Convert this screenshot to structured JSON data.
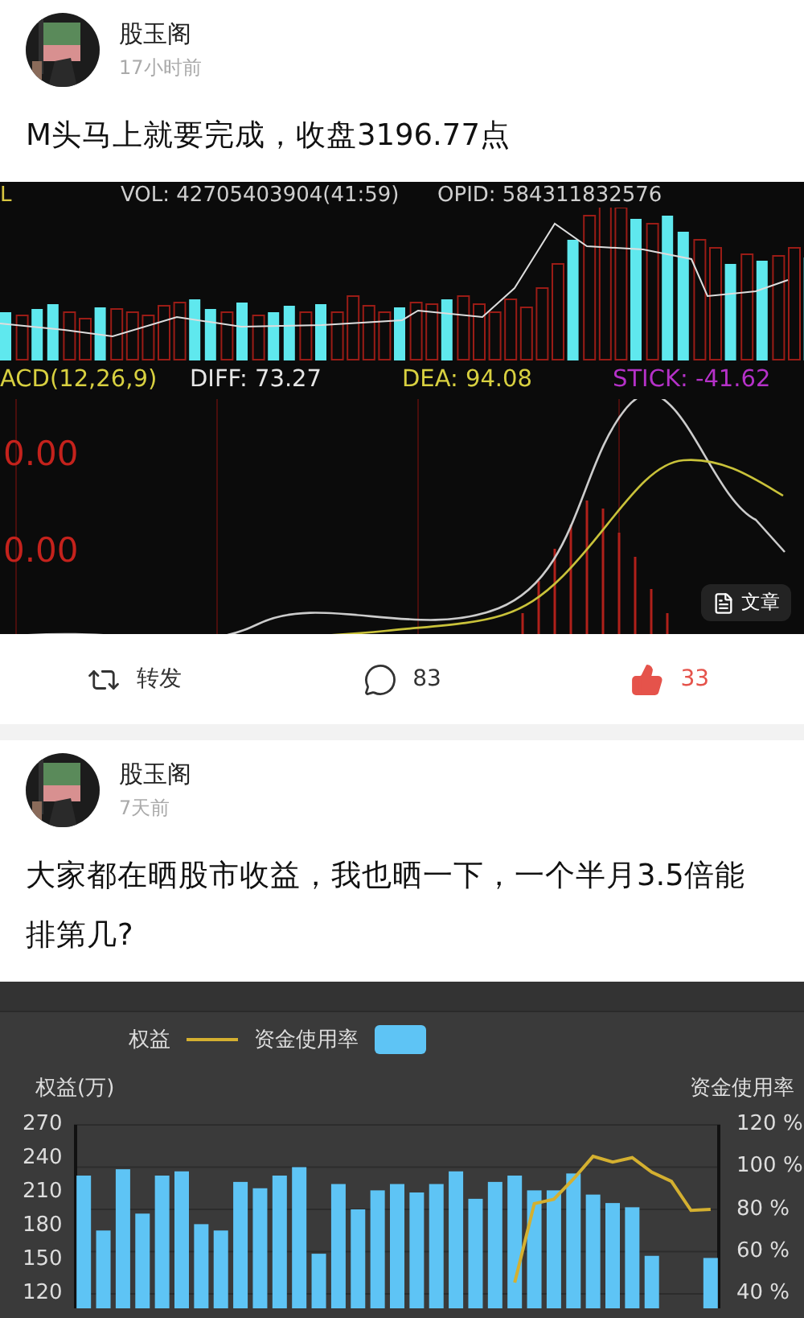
{
  "posts": [
    {
      "author": "股玉阁",
      "time": "17小时前",
      "text": "M头马上就要完成，收盘3196.77点",
      "avatar": {
        "kind": "picture"
      },
      "media": {
        "kind": "macd_screenshot",
        "top_labels": [
          {
            "text": "L",
            "color": "#d8c640"
          },
          {
            "text": "VOL: 42705403904(41:59)",
            "color": "#cfcfcf"
          },
          {
            "text": "OPID: 584311832576",
            "color": "#cfcfcf"
          }
        ],
        "macd_labels": [
          {
            "text": "ACD(12,26,9)",
            "color": "#d8d040"
          },
          {
            "text": "DIFF: 73.27",
            "color": "#e6e6e6"
          },
          {
            "text": "DEA: 94.08",
            "color": "#d8d040"
          },
          {
            "text": "STICK: -41.62",
            "color": "#b531c8"
          }
        ],
        "axis_labels": [
          "0.00",
          "0.00"
        ],
        "badge": "文章"
      },
      "actions": [
        {
          "kind": "share",
          "text": "转发"
        },
        {
          "kind": "comment",
          "text": "83"
        },
        {
          "kind": "like",
          "text": "33",
          "liked": true
        }
      ]
    },
    {
      "author": "股玉阁",
      "time": "7天前",
      "text": "大家都在晒股市收益，我也晒一下，一个半月3.5倍能排第几?",
      "avatar": {
        "kind": "picture"
      },
      "media": {
        "kind": "equity_chart",
        "left_axis": {
          "title": "权益(万)",
          "ticks": [
            "270",
            "240",
            "210",
            "180",
            "150",
            "120"
          ]
        },
        "chart_data": {
          "type": "bar",
          "ylabel": "资金使用率",
          "grid": true,
          "legend": "top",
          "ylim": [
            40,
            120
          ],
          "yticks": [
            {
              "value": 120,
              "label": "120 %"
            },
            {
              "value": 100,
              "label": "100 %"
            },
            {
              "value": 80,
              "label": "80 %"
            },
            {
              "value": 60,
              "label": "60 %"
            },
            {
              "value": 40,
              "label": "40 %"
            }
          ],
          "series": [
            {
              "name": "权益",
              "type": "line",
              "color": "#d4b030",
              "values": [
                null,
                null,
                null,
                null,
                null,
                null,
                null,
                null,
                null,
                null,
                null,
                null,
                null,
                null,
                null,
                null,
                null,
                null,
                null,
                null,
                null,
                null,
                45.3,
                82.7,
                84.8,
                94.4,
                105.1,
                102.4,
                104.5,
                97.6,
                93.3,
                79.5,
                80
              ]
            },
            {
              "name": "资金使用率",
              "type": "bar",
              "color": "#5ec4f5",
              "values": [
                96,
                70,
                99,
                78,
                96,
                98,
                73,
                70,
                93,
                90,
                96,
                100,
                59,
                92,
                80,
                89,
                92,
                88,
                92,
                98,
                85,
                93,
                96,
                89,
                89,
                97,
                87,
                83,
                81,
                58,
                null,
                null,
                57
              ]
            }
          ]
        }
      }
    }
  ]
}
